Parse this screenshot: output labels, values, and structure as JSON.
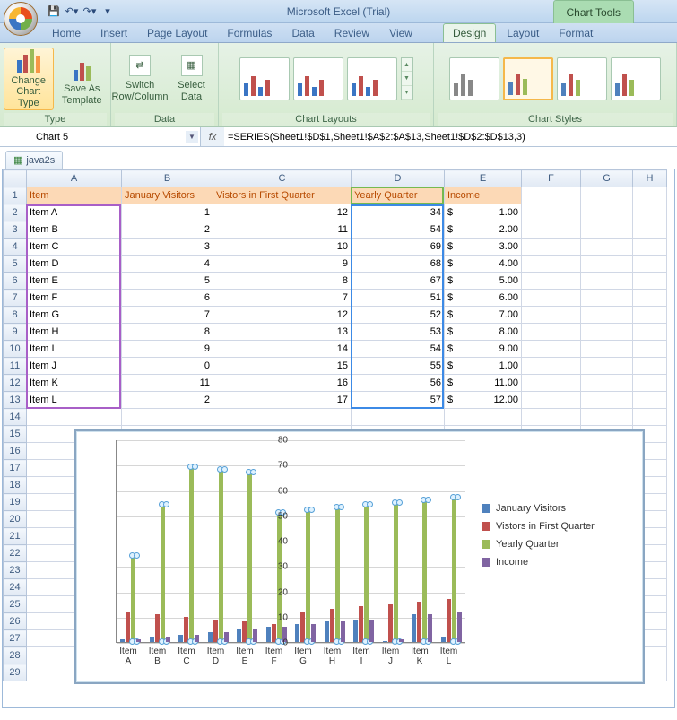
{
  "title": "Microsoft Excel (Trial)",
  "charttools_label": "Chart Tools",
  "qat": {
    "tips": [
      "save",
      "undo",
      "redo",
      "customize"
    ]
  },
  "tabs": [
    "Home",
    "Insert",
    "Page Layout",
    "Formulas",
    "Data",
    "Review",
    "View",
    "Design",
    "Layout",
    "Format"
  ],
  "tabs_active_index": 7,
  "ribbon": {
    "type": {
      "label": "Type",
      "change_chart_type": "Change\nChart Type",
      "save_as_template": "Save As\nTemplate"
    },
    "data": {
      "label": "Data",
      "switch": "Switch\nRow/Column",
      "select": "Select\nData"
    },
    "chart_layouts": {
      "label": "Chart Layouts"
    },
    "chart_styles": {
      "label": "Chart Styles"
    }
  },
  "namebox": "Chart 5",
  "formula": "=SERIES(Sheet1!$D$1,Sheet1!$A$2:$A$13,Sheet1!$D$2:$D$13,3)",
  "workbook_tab": "java2s",
  "columns": [
    "A",
    "B",
    "C",
    "D",
    "E",
    "F",
    "G",
    "H"
  ],
  "headers": {
    "A": "Item",
    "B": "January Visitors",
    "C": "Vistors in First Quarter",
    "D": "Yearly Quarter",
    "E": "Income"
  },
  "rows": [
    {
      "A": "Item A",
      "B": 1,
      "C": 12,
      "D": 34,
      "Ecur": "$",
      "E": "1.00"
    },
    {
      "A": "Item B",
      "B": 2,
      "C": 11,
      "D": 54,
      "Ecur": "$",
      "E": "2.00"
    },
    {
      "A": "Item C",
      "B": 3,
      "C": 10,
      "D": 69,
      "Ecur": "$",
      "E": "3.00"
    },
    {
      "A": "Item D",
      "B": 4,
      "C": 9,
      "D": 68,
      "Ecur": "$",
      "E": "4.00"
    },
    {
      "A": "Item E",
      "B": 5,
      "C": 8,
      "D": 67,
      "Ecur": "$",
      "E": "5.00"
    },
    {
      "A": "Item F",
      "B": 6,
      "C": 7,
      "D": 51,
      "Ecur": "$",
      "E": "6.00"
    },
    {
      "A": "Item G",
      "B": 7,
      "C": 12,
      "D": 52,
      "Ecur": "$",
      "E": "7.00"
    },
    {
      "A": "Item H",
      "B": 8,
      "C": 13,
      "D": 53,
      "Ecur": "$",
      "E": "8.00"
    },
    {
      "A": "Item I",
      "B": 9,
      "C": 14,
      "D": 54,
      "Ecur": "$",
      "E": "9.00"
    },
    {
      "A": "Item J",
      "B": 0,
      "C": 15,
      "D": 55,
      "Ecur": "$",
      "E": "1.00"
    },
    {
      "A": "Item K",
      "B": 11,
      "C": 16,
      "D": 56,
      "Ecur": "$",
      "E": "11.00"
    },
    {
      "A": "Item L",
      "B": 2,
      "C": 17,
      "D": 57,
      "Ecur": "$",
      "E": "12.00"
    }
  ],
  "chart_data": {
    "type": "bar",
    "categories": [
      "Item A",
      "Item B",
      "Item C",
      "Item D",
      "Item E",
      "Item F",
      "Item G",
      "Item H",
      "Item I",
      "Item J",
      "Item K",
      "Item L"
    ],
    "series": [
      {
        "name": "January Visitors",
        "color": "#4f81bd",
        "values": [
          1,
          2,
          3,
          4,
          5,
          6,
          7,
          8,
          9,
          0,
          11,
          2
        ]
      },
      {
        "name": "Vistors in First Quarter",
        "color": "#c0504d",
        "values": [
          12,
          11,
          10,
          9,
          8,
          7,
          12,
          13,
          14,
          15,
          16,
          17
        ]
      },
      {
        "name": "Yearly Quarter",
        "color": "#9bbb59",
        "values": [
          34,
          54,
          69,
          68,
          67,
          51,
          52,
          53,
          54,
          55,
          56,
          57
        ]
      },
      {
        "name": "Income",
        "color": "#8064a2",
        "values": [
          1,
          2,
          3,
          4,
          5,
          6,
          7,
          8,
          9,
          1,
          11,
          12
        ]
      }
    ],
    "ylim": [
      0,
      80
    ],
    "ytick": 10,
    "selected_series_index": 2
  }
}
